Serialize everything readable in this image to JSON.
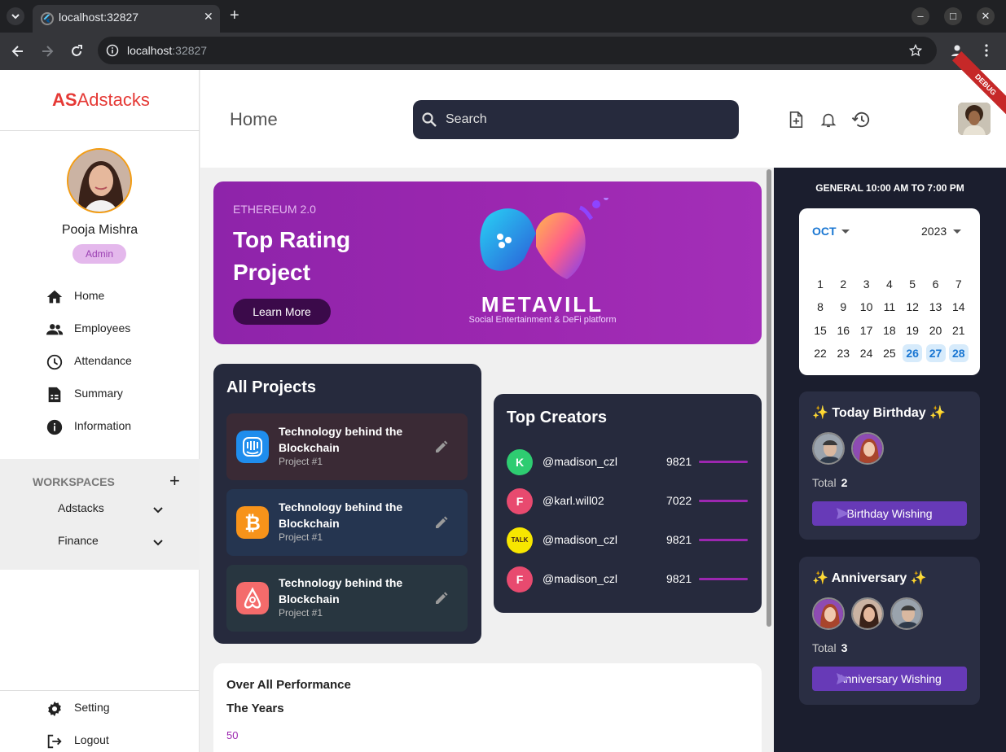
{
  "browser": {
    "tab_title": "localhost:32827",
    "url_host": "localhost",
    "url_port": ":32827",
    "new_tab": "+",
    "close_tab": "✕"
  },
  "sidebar": {
    "logo_bold": "AS",
    "logo_rest": "Adstacks",
    "user_name": "Pooja Mishra",
    "user_role": "Admin",
    "nav": [
      {
        "label": "Home",
        "icon": "home-icon"
      },
      {
        "label": "Employees",
        "icon": "people-icon"
      },
      {
        "label": "Attendance",
        "icon": "clock-icon"
      },
      {
        "label": "Summary",
        "icon": "summary-icon"
      },
      {
        "label": "Information",
        "icon": "info-icon"
      }
    ],
    "workspaces_title": "WORKSPACES",
    "workspaces": [
      "Adstacks",
      "Finance"
    ],
    "bottom": [
      {
        "label": "Setting",
        "icon": "gear-icon"
      },
      {
        "label": "Logout",
        "icon": "logout-icon"
      }
    ]
  },
  "header": {
    "title": "Home",
    "search_placeholder": "Search",
    "debug_label": "DEBUG"
  },
  "banner": {
    "eyebrow": "ETHEREUM 2.0",
    "title": "Top Rating Project",
    "button": "Learn More",
    "brand": "METAVILL",
    "tagline": "Social Entertainment & DeFi platform"
  },
  "projects": {
    "title": "All Projects",
    "items": [
      {
        "title": "Technology behind the Blockchain",
        "subtitle": "Project #1",
        "icon": "intercom-icon",
        "bg": "#3a2a35"
      },
      {
        "title": "Technology behind the Blockchain",
        "subtitle": "Project #1",
        "icon": "bitcoin-icon",
        "bg": "#253550"
      },
      {
        "title": "Technology behind the Blockchain",
        "subtitle": "Project #1",
        "icon": "airbnb-icon",
        "bg": "#283640"
      }
    ]
  },
  "creators": {
    "title": "Top Creators",
    "items": [
      {
        "handle": "@madison_czl",
        "score": "9821",
        "icon": "kik-icon",
        "color": "#2ecc71",
        "level": 1.0
      },
      {
        "handle": "@karl.will02",
        "score": "7022",
        "icon": "foursquare-icon",
        "color": "#e84a6f",
        "level": 1.0
      },
      {
        "handle": "@madison_czl",
        "score": "9821",
        "icon": "kakaotalk-icon",
        "color": "#f7e600",
        "level": 1.0
      },
      {
        "handle": "@madison_czl",
        "score": "9821",
        "icon": "foursquare-icon",
        "color": "#e84a6f",
        "level": 1.0
      }
    ]
  },
  "performance": {
    "line1": "Over  All Performance",
    "line2": "The Years",
    "axis_top": "50"
  },
  "schedule": {
    "shift": "GENERAL 10:00 AM TO 7:00 PM",
    "month": "OCT",
    "year": "2023",
    "weeks": [
      [
        "1",
        "2",
        "3",
        "4",
        "5",
        "6",
        "7"
      ],
      [
        "8",
        "9",
        "10",
        "11",
        "12",
        "13",
        "14"
      ],
      [
        "15",
        "16",
        "17",
        "18",
        "19",
        "20",
        "21"
      ],
      [
        "22",
        "23",
        "24",
        "25",
        "26",
        "27",
        "28"
      ]
    ],
    "highlighted": [
      "26",
      "27",
      "28"
    ]
  },
  "birthday": {
    "title": "Today Birthday",
    "total_label": "Total",
    "total": "2",
    "button": "Birthday Wishing"
  },
  "anniversary": {
    "title": "Anniversary",
    "total_label": "Total",
    "total": "3",
    "button": "Anniversary Wishing"
  },
  "colors": {
    "accent": "#9c27b0",
    "panel_dark": "#262a3d",
    "wish_button": "#673ab7",
    "logo": "#e53935"
  }
}
